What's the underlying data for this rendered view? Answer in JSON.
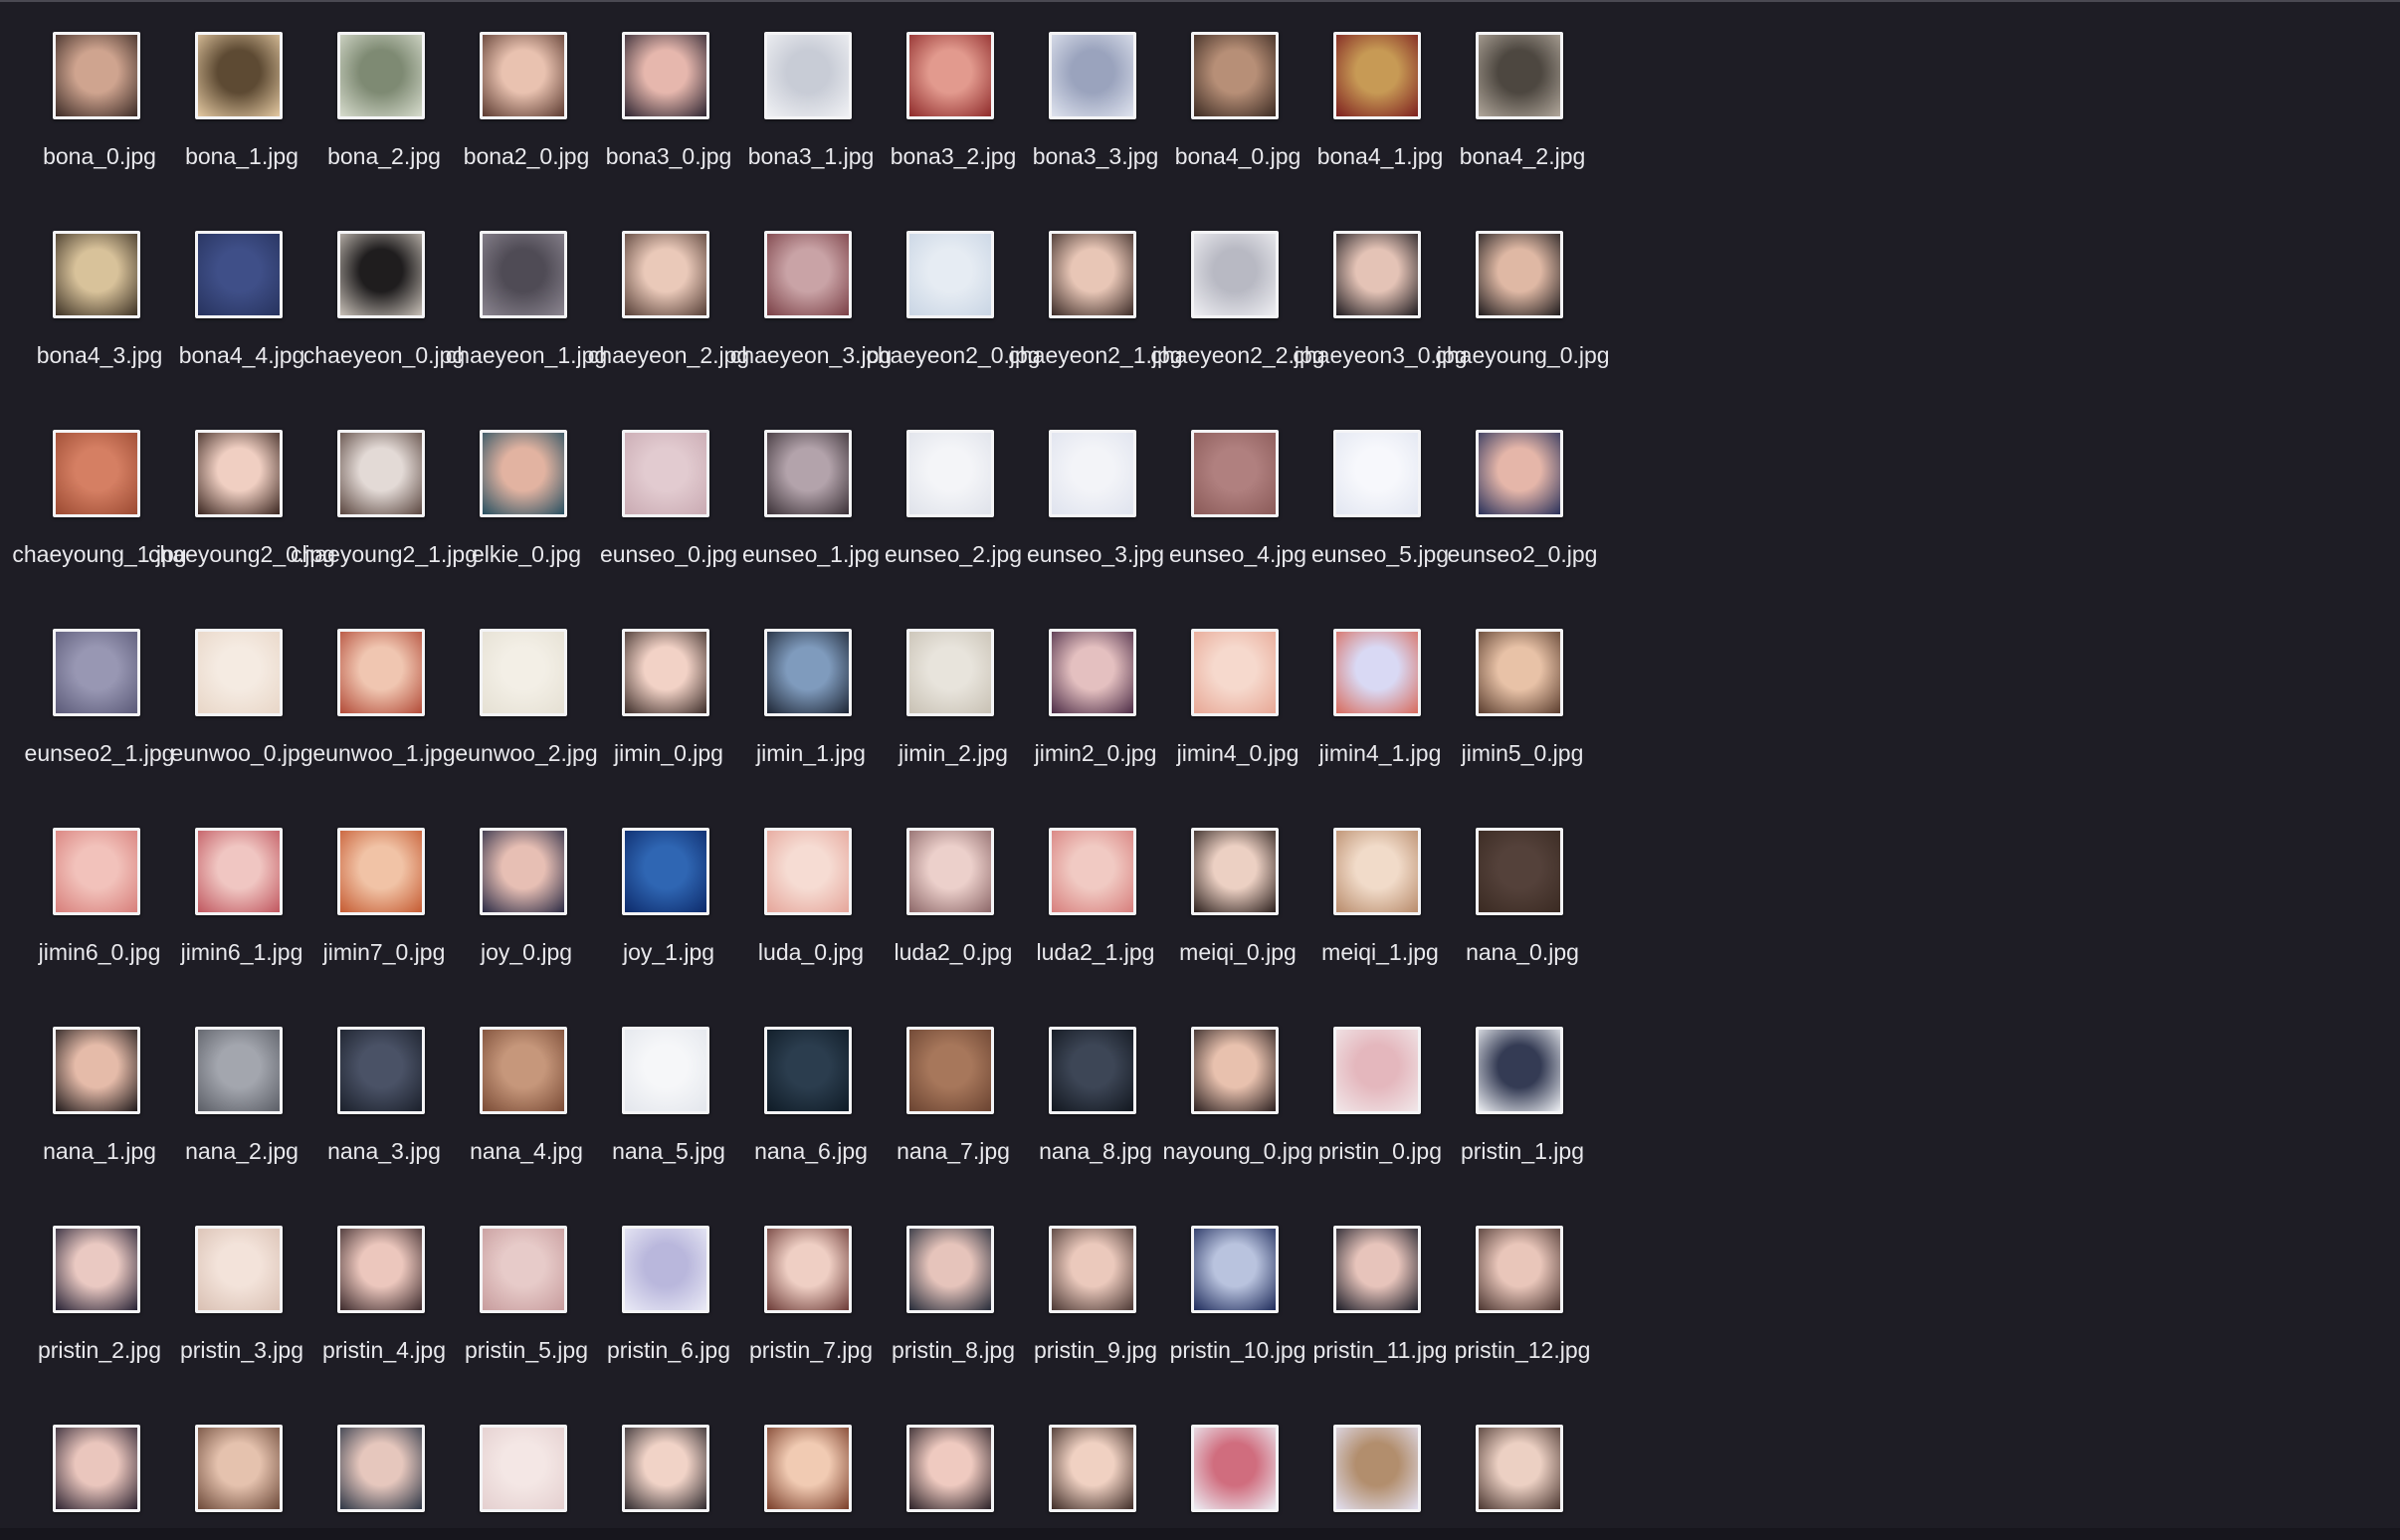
{
  "files": [
    {
      "name": "bona_0.jpg",
      "colors": [
        "#3b2a25",
        "#cfa48f"
      ]
    },
    {
      "name": "bona_1.jpg",
      "colors": [
        "#e4c9a2",
        "#5d4a33"
      ]
    },
    {
      "name": "bona_2.jpg",
      "colors": [
        "#d7dccd",
        "#7e8a73"
      ]
    },
    {
      "name": "bona2_0.jpg",
      "colors": [
        "#5b3a30",
        "#e9c2b0"
      ]
    },
    {
      "name": "bona3_0.jpg",
      "colors": [
        "#2c2430",
        "#e6b7ad"
      ]
    },
    {
      "name": "bona3_1.jpg",
      "colors": [
        "#f0f1f4",
        "#c8ccd6"
      ]
    },
    {
      "name": "bona3_2.jpg",
      "colors": [
        "#8e2a2a",
        "#e29a8e"
      ]
    },
    {
      "name": "bona3_3.jpg",
      "colors": [
        "#dfe3ee",
        "#9aa3bd"
      ]
    },
    {
      "name": "bona4_0.jpg",
      "colors": [
        "#3b2a22",
        "#b78f77"
      ]
    },
    {
      "name": "bona4_1.jpg",
      "colors": [
        "#7d1f1f",
        "#c79a55"
      ]
    },
    {
      "name": "bona4_2.jpg",
      "colors": [
        "#b1a79b",
        "#4d4740"
      ]
    },
    {
      "name": "bona4_3.jpg",
      "colors": [
        "#3c3124",
        "#d8c29a"
      ]
    },
    {
      "name": "bona4_4.jpg",
      "colors": [
        "#27335e",
        "#3f4f88"
      ]
    },
    {
      "name": "chaeyeon_0.jpg",
      "colors": [
        "#c9c1b8",
        "#1f1d1e"
      ]
    },
    {
      "name": "chaeyeon_1.jpg",
      "colors": [
        "#8b8590",
        "#4f4b55"
      ]
    },
    {
      "name": "chaeyeon_2.jpg",
      "colors": [
        "#553e36",
        "#eac9b9"
      ]
    },
    {
      "name": "chaeyeon_3.jpg",
      "colors": [
        "#7a3f45",
        "#c9a3a6"
      ]
    },
    {
      "name": "chaeyeon2_0.jpg",
      "colors": [
        "#c9d5e4",
        "#e6ecf3"
      ]
    },
    {
      "name": "chaeyeon2_1.jpg",
      "colors": [
        "#3a2a26",
        "#e8c6b6"
      ]
    },
    {
      "name": "chaeyeon2_2.jpg",
      "colors": [
        "#eeeef2",
        "#b8b9c3"
      ]
    },
    {
      "name": "chaeyeon3_0.jpg",
      "colors": [
        "#1d1a1f",
        "#e4c3b6"
      ]
    },
    {
      "name": "chaeyoung_0.jpg",
      "colors": [
        "#1e1b1d",
        "#dfb8a4"
      ]
    },
    {
      "name": "chaeyoung_1.jpg",
      "colors": [
        "#9b4a32",
        "#d57f63"
      ]
    },
    {
      "name": "chaeyoung2_0.jpg",
      "colors": [
        "#3a2620",
        "#f0cfc2"
      ]
    },
    {
      "name": "chaeyoung2_1.jpg",
      "colors": [
        "#5a463f",
        "#e3dad6"
      ]
    },
    {
      "name": "elkie_0.jpg",
      "colors": [
        "#264f61",
        "#e2b3a1"
      ]
    },
    {
      "name": "eunseo_0.jpg",
      "colors": [
        "#c9aab2",
        "#e2cbd0"
      ]
    },
    {
      "name": "eunseo_1.jpg",
      "colors": [
        "#3a3036",
        "#b3a3ab"
      ]
    },
    {
      "name": "eunseo_2.jpg",
      "colors": [
        "#dfe2ea",
        "#f4f5f8"
      ]
    },
    {
      "name": "eunseo_3.jpg",
      "colors": [
        "#dfe3ee",
        "#f3f4f8"
      ]
    },
    {
      "name": "eunseo_4.jpg",
      "colors": [
        "#8a5a58",
        "#b0807f"
      ]
    },
    {
      "name": "eunseo_5.jpg",
      "colors": [
        "#e2e6f1",
        "#f7f8fc"
      ]
    },
    {
      "name": "eunseo2_0.jpg",
      "colors": [
        "#28305a",
        "#e5b6a9"
      ]
    },
    {
      "name": "eunseo2_1.jpg",
      "colors": [
        "#5b5a78",
        "#9897b3"
      ]
    },
    {
      "name": "eunwoo_0.jpg",
      "colors": [
        "#e8d6c7",
        "#f5ebe2"
      ]
    },
    {
      "name": "eunwoo_1.jpg",
      "colors": [
        "#b24a37",
        "#f0c6b1"
      ]
    },
    {
      "name": "eunwoo_2.jpg",
      "colors": [
        "#e5e0d3",
        "#f3efe6"
      ]
    },
    {
      "name": "jimin_0.jpg",
      "colors": [
        "#3c2d29",
        "#f2d2c6"
      ]
    },
    {
      "name": "jimin_1.jpg",
      "colors": [
        "#1d2534",
        "#7f9bbd"
      ]
    },
    {
      "name": "jimin_2.jpg",
      "colors": [
        "#c8c1b4",
        "#e8e4dc"
      ]
    },
    {
      "name": "jimin2_0.jpg",
      "colors": [
        "#4b2b45",
        "#e4c0c0"
      ]
    },
    {
      "name": "jimin4_0.jpg",
      "colors": [
        "#e7a795",
        "#f6d9cd"
      ]
    },
    {
      "name": "jimin4_1.jpg",
      "colors": [
        "#d76a5c",
        "#d9d9f4"
      ]
    },
    {
      "name": "jimin5_0.jpg",
      "colors": [
        "#5a3d2e",
        "#e8c2a7"
      ]
    },
    {
      "name": "jimin6_0.jpg",
      "colors": [
        "#d77e7a",
        "#f2c2bb"
      ]
    },
    {
      "name": "jimin6_1.jpg",
      "colors": [
        "#c0565e",
        "#f0c6c2"
      ]
    },
    {
      "name": "jimin7_0.jpg",
      "colors": [
        "#c55a31",
        "#f1c3a6"
      ]
    },
    {
      "name": "joy_0.jpg",
      "colors": [
        "#2a2a44",
        "#e7bfb4"
      ]
    },
    {
      "name": "joy_1.jpg",
      "colors": [
        "#0d2a6a",
        "#2f66b3"
      ]
    },
    {
      "name": "luda_0.jpg",
      "colors": [
        "#e5a59a",
        "#f6dcd3"
      ]
    },
    {
      "name": "luda2_0.jpg",
      "colors": [
        "#8c6768",
        "#ecd0cb"
      ]
    },
    {
      "name": "luda2_1.jpg",
      "colors": [
        "#d77e7c",
        "#f1cac3"
      ]
    },
    {
      "name": "meiqi_0.jpg",
      "colors": [
        "#2b1f1c",
        "#ecd0c3"
      ]
    },
    {
      "name": "meiqi_1.jpg",
      "colors": [
        "#b88b6b",
        "#f1dbc9"
      ]
    },
    {
      "name": "nana_0.jpg",
      "colors": [
        "#3a2a22",
        "#54413a"
      ]
    },
    {
      "name": "nana_1.jpg",
      "colors": [
        "#1e1819",
        "#e5bba9"
      ]
    },
    {
      "name": "nana_2.jpg",
      "colors": [
        "#5b5e66",
        "#a3a6ae"
      ]
    },
    {
      "name": "nana_3.jpg",
      "colors": [
        "#1b202b",
        "#4a5266"
      ]
    },
    {
      "name": "nana_4.jpg",
      "colors": [
        "#7a4b36",
        "#c6977b"
      ]
    },
    {
      "name": "nana_5.jpg",
      "colors": [
        "#e3e6ec",
        "#f6f7f9"
      ]
    },
    {
      "name": "nana_6.jpg",
      "colors": [
        "#0f1b26",
        "#2b3d4e"
      ]
    },
    {
      "name": "nana_7.jpg",
      "colors": [
        "#6a4331",
        "#a7775b"
      ]
    },
    {
      "name": "nana_8.jpg",
      "colors": [
        "#12171f",
        "#3d4656"
      ]
    },
    {
      "name": "nayoung_0.jpg",
      "colors": [
        "#2a1f1f",
        "#e8c1ae"
      ]
    },
    {
      "name": "pristin_0.jpg",
      "colors": [
        "#f1e7e9",
        "#e4b7bd"
      ]
    },
    {
      "name": "pristin_1.jpg",
      "colors": [
        "#eef0f4",
        "#343b54"
      ]
    },
    {
      "name": "pristin_2.jpg",
      "colors": [
        "#252033",
        "#eac9c2"
      ]
    },
    {
      "name": "pristin_3.jpg",
      "colors": [
        "#d9c0b3",
        "#f3e3da"
      ]
    },
    {
      "name": "pristin_4.jpg",
      "colors": [
        "#3c2a2c",
        "#ecc7bd"
      ]
    },
    {
      "name": "pristin_5.jpg",
      "colors": [
        "#c79c9d",
        "#e7cbc9"
      ]
    },
    {
      "name": "pristin_6.jpg",
      "colors": [
        "#eaeaf6",
        "#b9b7dc"
      ]
    },
    {
      "name": "pristin_7.jpg",
      "colors": [
        "#6b3a36",
        "#efcfc4"
      ]
    },
    {
      "name": "pristin_8.jpg",
      "colors": [
        "#242a38",
        "#e6c4bb"
      ]
    },
    {
      "name": "pristin_9.jpg",
      "colors": [
        "#4a3733",
        "#ebc9bc"
      ]
    },
    {
      "name": "pristin_10.jpg",
      "colors": [
        "#1d2a5a",
        "#b9c3de"
      ]
    },
    {
      "name": "pristin_11.jpg",
      "colors": [
        "#1a1b26",
        "#e7c4bb"
      ]
    },
    {
      "name": "pristin_12.jpg",
      "colors": [
        "#4b3530",
        "#e9c6ba"
      ]
    },
    {
      "name": "",
      "colors": [
        "#2c2230",
        "#eac6bd"
      ]
    },
    {
      "name": "",
      "colors": [
        "#6d4a3a",
        "#e5c2ae"
      ]
    },
    {
      "name": "",
      "colors": [
        "#2d3646",
        "#e6c7bd"
      ]
    },
    {
      "name": "",
      "colors": [
        "#e4cfcf",
        "#f4e7e5"
      ]
    },
    {
      "name": "",
      "colors": [
        "#2f2a2e",
        "#f1d3c7"
      ]
    },
    {
      "name": "",
      "colors": [
        "#7a3e2a",
        "#f1cbb3"
      ]
    },
    {
      "name": "",
      "colors": [
        "#2a2026",
        "#efcac0"
      ]
    },
    {
      "name": "",
      "colors": [
        "#3d2b26",
        "#f0d1c2"
      ]
    },
    {
      "name": "",
      "colors": [
        "#eceef5",
        "#d06d7e"
      ]
    },
    {
      "name": "",
      "colors": [
        "#e2dff0",
        "#b28e6d"
      ]
    },
    {
      "name": "",
      "colors": [
        "#4a3630",
        "#ecd0c3"
      ]
    }
  ]
}
